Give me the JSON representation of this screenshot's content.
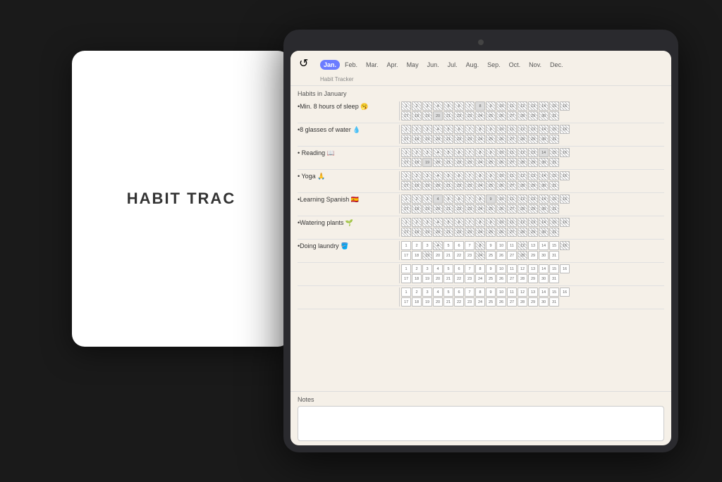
{
  "scene": {
    "background": "#1a1a1a"
  },
  "back_tablet": {
    "title": "HABIT TRAC"
  },
  "front_tablet": {
    "app": {
      "icon": "↺",
      "subtitle": "Habit Tracker",
      "months": [
        "Jan.",
        "Feb.",
        "Mar.",
        "Apr.",
        "May",
        "Jun.",
        "Jul.",
        "Aug.",
        "Sep.",
        "Oct.",
        "Nov.",
        "Dec."
      ],
      "active_month": "Jan.",
      "section_title": "Habits in January"
    },
    "habits": [
      {
        "label": "•Min. 8 hours of sleep 🥱"
      },
      {
        "label": "•8 glasses of water 💧"
      },
      {
        "label": "• Reading 📖"
      },
      {
        "label": "• Yoga 🙏"
      },
      {
        "label": "•Learning Spanish 🇪🇸"
      },
      {
        "label": "•Watering plants 🌱"
      },
      {
        "label": "•Doing laundry 🪣"
      }
    ],
    "notes": {
      "title": "Notes"
    }
  }
}
